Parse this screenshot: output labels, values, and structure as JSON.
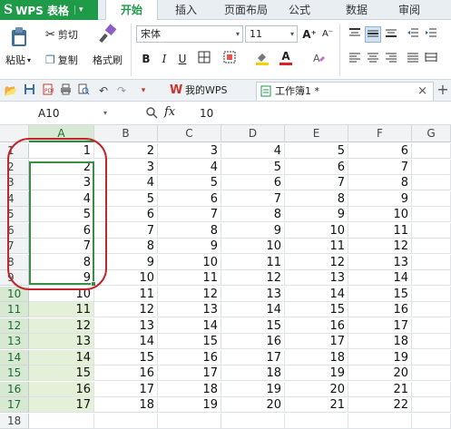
{
  "app": {
    "logo": "S",
    "name": "WPS 表格",
    "menu_arrow": "▾"
  },
  "ribbon_tabs": [
    "开始",
    "插入",
    "页面布局",
    "公式",
    "数据",
    "审阅"
  ],
  "ribbon": {
    "paste": "粘贴",
    "cut": "剪切",
    "copy": "复制",
    "format_painter": "格式刷",
    "font_name": "宋体",
    "font_size": "11",
    "bold": "B",
    "italic": "I",
    "underline": "U",
    "font_color_letter": "A",
    "increase_font": "A⁺",
    "decrease_font": "A⁻"
  },
  "quickbar": {
    "my_wps": "我的WPS",
    "workbook_tab": "工作簿1 *",
    "close": "×",
    "new_tab": "+"
  },
  "formula_bar": {
    "name_box": "A10",
    "fx": "fx",
    "zoom": "🔍",
    "value": "10"
  },
  "columns": [
    "A",
    "B",
    "C",
    "D",
    "E",
    "F",
    "G"
  ],
  "rows": [
    {
      "n": "1",
      "cells": [
        "1",
        "2",
        "3",
        "4",
        "5",
        "6",
        ""
      ]
    },
    {
      "n": "2",
      "cells": [
        "2",
        "3",
        "4",
        "5",
        "6",
        "7",
        ""
      ]
    },
    {
      "n": "3",
      "cells": [
        "3",
        "4",
        "5",
        "6",
        "7",
        "8",
        ""
      ]
    },
    {
      "n": "4",
      "cells": [
        "4",
        "5",
        "6",
        "7",
        "8",
        "9",
        ""
      ]
    },
    {
      "n": "5",
      "cells": [
        "5",
        "6",
        "7",
        "8",
        "9",
        "10",
        ""
      ]
    },
    {
      "n": "6",
      "cells": [
        "6",
        "7",
        "8",
        "9",
        "10",
        "11",
        ""
      ]
    },
    {
      "n": "7",
      "cells": [
        "7",
        "8",
        "9",
        "10",
        "11",
        "12",
        ""
      ]
    },
    {
      "n": "8",
      "cells": [
        "8",
        "9",
        "10",
        "11",
        "12",
        "13",
        ""
      ]
    },
    {
      "n": "9",
      "cells": [
        "9",
        "10",
        "11",
        "12",
        "13",
        "14",
        ""
      ]
    },
    {
      "n": "10",
      "cells": [
        "10",
        "11",
        "12",
        "13",
        "14",
        "15",
        ""
      ]
    },
    {
      "n": "11",
      "cells": [
        "11",
        "12",
        "13",
        "14",
        "15",
        "16",
        ""
      ]
    },
    {
      "n": "12",
      "cells": [
        "12",
        "13",
        "14",
        "15",
        "16",
        "17",
        ""
      ]
    },
    {
      "n": "13",
      "cells": [
        "13",
        "14",
        "15",
        "16",
        "17",
        "18",
        ""
      ]
    },
    {
      "n": "14",
      "cells": [
        "14",
        "15",
        "16",
        "17",
        "18",
        "19",
        ""
      ]
    },
    {
      "n": "15",
      "cells": [
        "15",
        "16",
        "17",
        "18",
        "19",
        "20",
        ""
      ]
    },
    {
      "n": "16",
      "cells": [
        "16",
        "17",
        "18",
        "19",
        "20",
        "21",
        ""
      ]
    },
    {
      "n": "17",
      "cells": [
        "17",
        "18",
        "19",
        "20",
        "21",
        "22",
        ""
      ]
    },
    {
      "n": "18",
      "cells": [
        "",
        "",
        "",
        "",
        "",
        "",
        ""
      ]
    }
  ],
  "selection": {
    "range": "A10:A17",
    "active_cell": "A10"
  },
  "colors": {
    "brand_green": "#1f9a48",
    "selection_fill": "#e5f0d8",
    "annotation_red": "#c1272d"
  }
}
